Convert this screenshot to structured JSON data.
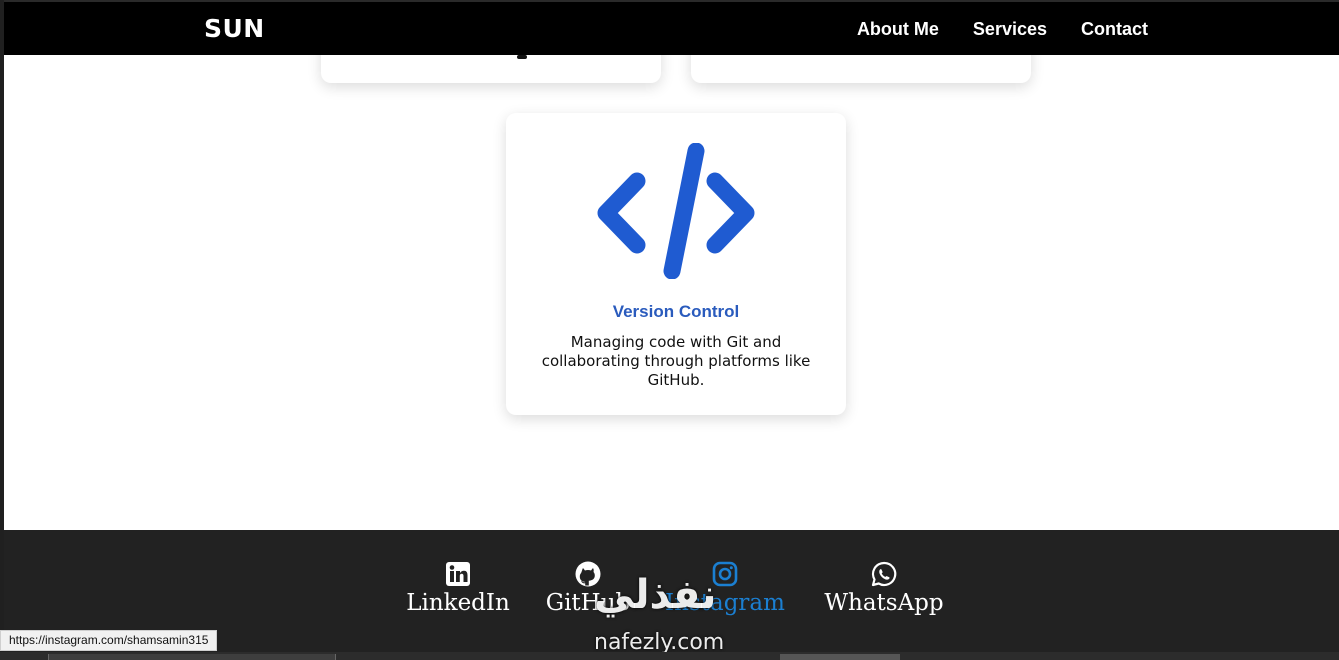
{
  "nav": {
    "logo": "SUN",
    "links": [
      "About Me",
      "Services",
      "Contact"
    ]
  },
  "service_card": {
    "icon": "code-icon",
    "title": "Version Control",
    "description": "Managing code with Git and collaborating through platforms like GitHub."
  },
  "footer": {
    "social": [
      {
        "label": "LinkedIn",
        "icon": "linkedin-icon"
      },
      {
        "label": "GitHub",
        "icon": "github-icon"
      },
      {
        "label": "Instagram",
        "icon": "instagram-icon"
      },
      {
        "label": "WhatsApp",
        "icon": "whatsapp-icon"
      }
    ]
  },
  "watermark": {
    "arabic": "نفذلي",
    "latin": "nafezly.com"
  },
  "status_bar": {
    "url": "https://instagram.com/shamsamin315"
  },
  "colors": {
    "accent": "#2a5bbd",
    "icon_blue": "#1f5bd1",
    "hover_link": "#1b7fd1",
    "navbar": "#000000",
    "footer": "#222222"
  }
}
